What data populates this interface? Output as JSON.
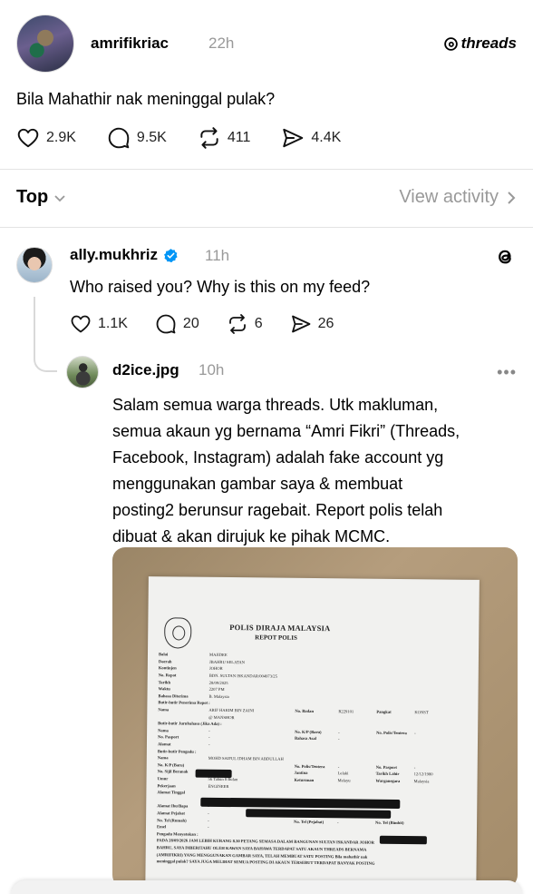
{
  "post": {
    "username": "amrifikriac",
    "time": "22h",
    "brand": "threads",
    "text": "Bila Mahathir nak meninggal pulak?",
    "stats": {
      "likes": "2.9K",
      "replies": "9.5K",
      "reposts": "411",
      "shares": "4.4K"
    }
  },
  "sort": {
    "label": "Top",
    "view_activity": "View activity"
  },
  "reply": {
    "username": "ally.mukhriz",
    "verified": true,
    "time": "11h",
    "text": "Who raised you? Why is this on my feed?",
    "stats": {
      "likes": "1.1K",
      "replies": "20",
      "reposts": "6",
      "shares": "26"
    }
  },
  "nested_reply": {
    "username": "d2ice.jpg",
    "time": "10h",
    "more": "•••",
    "lines": [
      "Salam semua warga threads. Utk makluman,",
      "semua akaun yg bernama “Amri Fikri” (Threads,",
      "Facebook, Instagram) adalah fake account yg",
      "menggunakan gambar saya & membuat",
      "posting2 berunsur ragebait. Report polis telah",
      "dibuat & akan dirujuk ke pihak MCMC."
    ]
  },
  "photo_document": {
    "title": "POLIS DIRAJA MALAYSIA",
    "subtitle": "REPOT POLIS",
    "rows": [
      {
        "lbl": "Balai",
        "val": "MAJIDEE"
      },
      {
        "lbl": "Daerah",
        "val": "JBAHRU SELATAN"
      },
      {
        "lbl": "Kontinjen",
        "val": "JOHOR"
      },
      {
        "lbl": "No. Repot",
        "val": "BDN. SULTAN ISKANDAR/004973/25"
      },
      {
        "lbl": "Tarikh",
        "val": "28/09/2025"
      },
      {
        "lbl": "Waktu",
        "val": "2207 PM"
      },
      {
        "lbl": "Bahasa Diterima",
        "val": "B. Malaysia"
      },
      {
        "section": "Butir-butir Penerima Repot :"
      },
      {
        "lbl": "Nama",
        "val": "ARIF HAKIM BIN ZAINI",
        "lbl2": "No. Badan",
        "val2": "R229101",
        "lbl3": "Pangkat",
        "val3": "KONST"
      },
      {
        "lbl": "",
        "val": "@ MANSHOR"
      },
      {
        "section": "Butir-butir Jurubahasa (Jika Ada) :"
      },
      {
        "lbl": "Nama",
        "val": "-",
        "lbl2": "No. K/P (Baru)",
        "val2": "-",
        "lbl3": "No. Polis/Tentera",
        "val3": "-"
      },
      {
        "lbl": "No. Pasport",
        "val": "-",
        "lbl2": "Bahasa Asal",
        "val2": "-"
      },
      {
        "lbl": "Alamat",
        "val": "-"
      },
      {
        "section": "Butir-butir Pengadu :"
      },
      {
        "lbl": "Nama",
        "val": "MOHD SAIFUL IDHAM BIN ABDULLAH"
      },
      {
        "lbl": "No. K/P (Baru)",
        "val": "",
        "lbl2": "No. Polis/Tentera",
        "val2": "-",
        "lbl3": "No. Pasport",
        "val3": "-"
      },
      {
        "lbl": "No. Sijil Beranak",
        "val": "-",
        "lbl2": "Jantina",
        "val2": "Lelaki",
        "lbl3": "Tarikh Lahir",
        "val3": "12/12/1980"
      },
      {
        "lbl": "Umur",
        "val": "56 Tahun 8 Bulan",
        "lbl2": "Keturunan",
        "val2": "Melayu",
        "lbl3": "Warganegara",
        "val3": "Malaysia"
      },
      {
        "lbl": "Pekerjaan",
        "val": "ENGINEER"
      },
      {
        "lbl": "Alamat Tinggal",
        "val": ""
      },
      {
        "lbl": "",
        "val": ""
      },
      {
        "lbl": "Alamat Ibu/Bapa",
        "val": "-"
      },
      {
        "lbl": "Alamat Pejabat",
        "val": "-"
      },
      {
        "lbl": "No. Tel (Rumah)",
        "val": "-",
        "lbl2": "No. Tel (Pejabat)",
        "val2": "-",
        "lbl3": "No. Tel (Bimbit)",
        "val3": ""
      },
      {
        "lbl": "Emel",
        "val": "-"
      },
      {
        "section": "Pengadu Menyatakan :"
      },
      {
        "section": "PADA 28/09/2026 JAM LEBIH KURANG 8.30 PETANG SEMASA DALAM BANGUNAN SULTAN ISKANDAR JOHOR"
      },
      {
        "section": "BAHRU, SAYA DIBERITAHU OLEH KAWAN SAYA BAHAWA TERDAPAT SATU AKAUN THREADS BERNAMA"
      },
      {
        "section": "(AMRIFIKRI) YANG MENGGUNAKAN GAMBAR SAYA, TELAH MEMBUAT SATU POSTING Bila mahathir nak"
      },
      {
        "section": "meninggal pulak? SAYA JUGA MELIHAT SEMUA POSTING DI AKAUN TERSEBUT TERDAPAT BANYAK POSTING"
      }
    ]
  }
}
